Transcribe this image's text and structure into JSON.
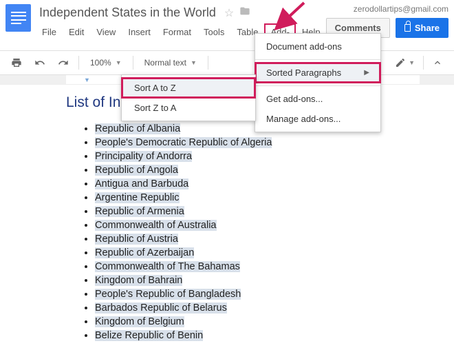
{
  "header": {
    "doc_title": "Independent States in the World",
    "user_email": "zerodollartips@gmail.com",
    "comments_label": "Comments",
    "share_label": "Share"
  },
  "menubar": {
    "file": "File",
    "edit": "Edit",
    "view": "View",
    "insert": "Insert",
    "format": "Format",
    "tools": "Tools",
    "table": "Table",
    "addons": "Add-ons",
    "help": "Help"
  },
  "toolbar": {
    "zoom": "100%",
    "style": "Normal text"
  },
  "addons_menu": {
    "doc_addons": "Document add-ons",
    "sorted_paragraphs": "Sorted Paragraphs",
    "get_addons": "Get add-ons...",
    "manage_addons": "Manage add-ons..."
  },
  "sort_menu": {
    "az": "Sort A to Z",
    "za": "Sort Z to A"
  },
  "page": {
    "heading_partial": "List of In",
    "items": [
      "Republic of Albania",
      "People's Democratic Republic of Algeria",
      "Principality of Andorra",
      "Republic of Angola",
      "Antigua and Barbuda",
      "Argentine Republic",
      "Republic of Armenia",
      "Commonwealth of Australia",
      "Republic of Austria",
      "Republic of Azerbaijan",
      "Commonwealth of The Bahamas",
      "Kingdom of Bahrain",
      "People's Republic of Bangladesh",
      "Barbados Republic of Belarus",
      "Kingdom of Belgium",
      "Belize Republic of Benin"
    ]
  }
}
